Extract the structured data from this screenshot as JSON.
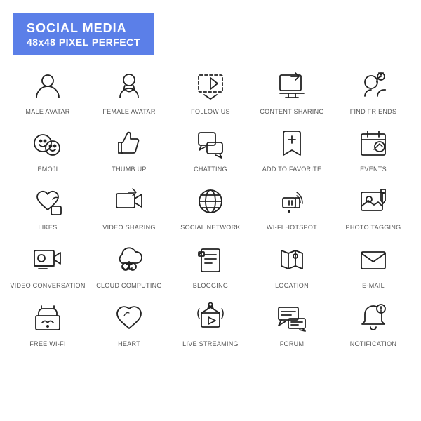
{
  "header": {
    "title": "SOCIAL MEDIA",
    "subtitle": "48x48 PIXEL PERFECT"
  },
  "icons": [
    {
      "id": "male-avatar",
      "label": "MALE AVATAR"
    },
    {
      "id": "female-avatar",
      "label": "FEMALE AVATAR"
    },
    {
      "id": "follow-us",
      "label": "FOLLOW US"
    },
    {
      "id": "content-sharing",
      "label": "CONTENT SHARING"
    },
    {
      "id": "find-friends",
      "label": "FIND FRIENDS"
    },
    {
      "id": "emoji",
      "label": "EMOJI"
    },
    {
      "id": "thumb-up",
      "label": "THUMB UP"
    },
    {
      "id": "chatting",
      "label": "CHATTING"
    },
    {
      "id": "add-to-favorite",
      "label": "ADD TO FAVORITE"
    },
    {
      "id": "events",
      "label": "EVENTS"
    },
    {
      "id": "likes",
      "label": "LIKES"
    },
    {
      "id": "video-sharing",
      "label": "VIDEO SHARING"
    },
    {
      "id": "social-network",
      "label": "SOCIAL NETWORK"
    },
    {
      "id": "wi-fi-hotspot",
      "label": "WI-FI HOTSPOT"
    },
    {
      "id": "photo-tagging",
      "label": "PHOTO TAGGING"
    },
    {
      "id": "video-conversation",
      "label": "VIDEO CONVERSATION"
    },
    {
      "id": "cloud-computing",
      "label": "CLOUD COMPUTING"
    },
    {
      "id": "blogging",
      "label": "BLOGGING"
    },
    {
      "id": "location",
      "label": "LOCATION"
    },
    {
      "id": "e-mail",
      "label": "E-MAIL"
    },
    {
      "id": "free-wi-fi",
      "label": "FREE WI-FI"
    },
    {
      "id": "heart",
      "label": "HEART"
    },
    {
      "id": "live-streaming",
      "label": "LIVE STREAMING"
    },
    {
      "id": "forum",
      "label": "FORUM"
    },
    {
      "id": "notification",
      "label": "NOTIFICATION"
    }
  ]
}
